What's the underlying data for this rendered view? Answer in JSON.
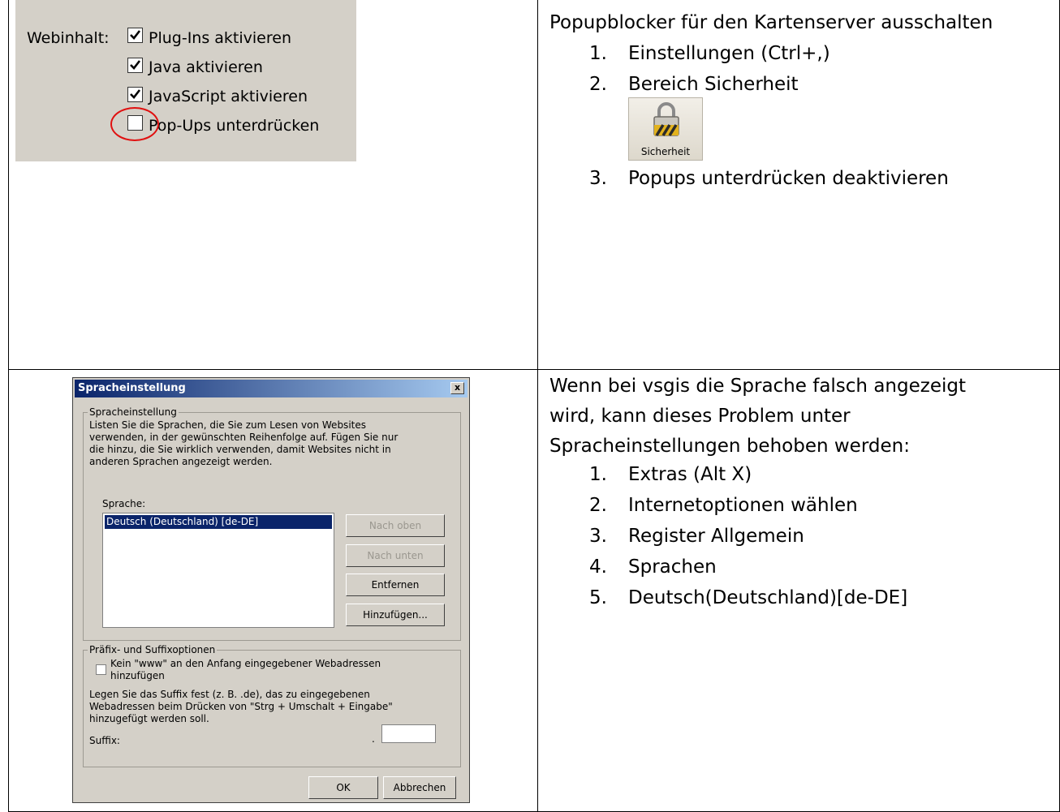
{
  "top_left_screenshot": {
    "label": "Webinhalt:",
    "options": [
      {
        "label": "Plug-Ins aktivieren",
        "checked": true
      },
      {
        "label": "Java aktivieren",
        "checked": true
      },
      {
        "label": "JavaScript aktivieren",
        "checked": true
      },
      {
        "label": "Pop-Ups unterdrücken",
        "checked": false
      }
    ],
    "highlight_color": "#e01010"
  },
  "top_right": {
    "heading": "Popupblocker für den Kartenserver ausschalten",
    "steps": [
      {
        "num": "1.",
        "text": "Einstellungen (Ctrl+,)"
      },
      {
        "num": "2.",
        "text": "Bereich Sicherheit"
      }
    ],
    "icon_label": "Sicherheit",
    "steps_after": [
      {
        "num": "3.",
        "text": "Popups unterdrücken deaktivieren"
      }
    ]
  },
  "dialog": {
    "title": "Spracheinstellung",
    "close_label": "x",
    "group1": {
      "legend": "Spracheinstellung",
      "description": [
        "Listen Sie die Sprachen, die Sie zum Lesen von Websites",
        "verwenden, in der gewünschten Reihenfolge auf. Fügen Sie nur",
        "die hinzu, die Sie wirklich verwenden, damit Websites nicht in",
        "anderen Sprachen angezeigt werden."
      ],
      "list_label": "Sprache:",
      "languages": [
        "Deutsch (Deutschland) [de-DE]"
      ],
      "buttons": {
        "up": "Nach oben",
        "down": "Nach unten",
        "remove": "Entfernen",
        "add": "Hinzufügen..."
      }
    },
    "group2": {
      "legend": "Präfix- und Suffixoptionen",
      "checkbox_lines": [
        "Kein \"www\" an den Anfang eingegebener Webadressen",
        "hinzufügen"
      ],
      "checkbox_checked": false,
      "description": [
        "Legen Sie das Suffix fest (z. B. .de), das zu eingegebenen",
        "Webadressen beim Drücken von \"Strg + Umschalt + Eingabe\"",
        "hinzugefügt werden soll."
      ],
      "suffix_label": "Suffix:",
      "suffix_dot": ".",
      "suffix_value": ""
    },
    "ok": "OK",
    "cancel": "Abbrechen"
  },
  "bottom_right": {
    "intro": [
      "Wenn bei vsgis die Sprache falsch angezeigt",
      "wird, kann dieses Problem unter",
      "Spracheinstellungen behoben werden:"
    ],
    "steps": [
      {
        "num": "1.",
        "text": "Extras (Alt X)"
      },
      {
        "num": "2.",
        "text": "Internetoptionen wählen"
      },
      {
        "num": "3.",
        "text": "Register Allgemein"
      },
      {
        "num": "4.",
        "text": "Sprachen"
      },
      {
        "num": "5.",
        "text": "Deutsch(Deutschland)[de-DE]"
      }
    ]
  }
}
